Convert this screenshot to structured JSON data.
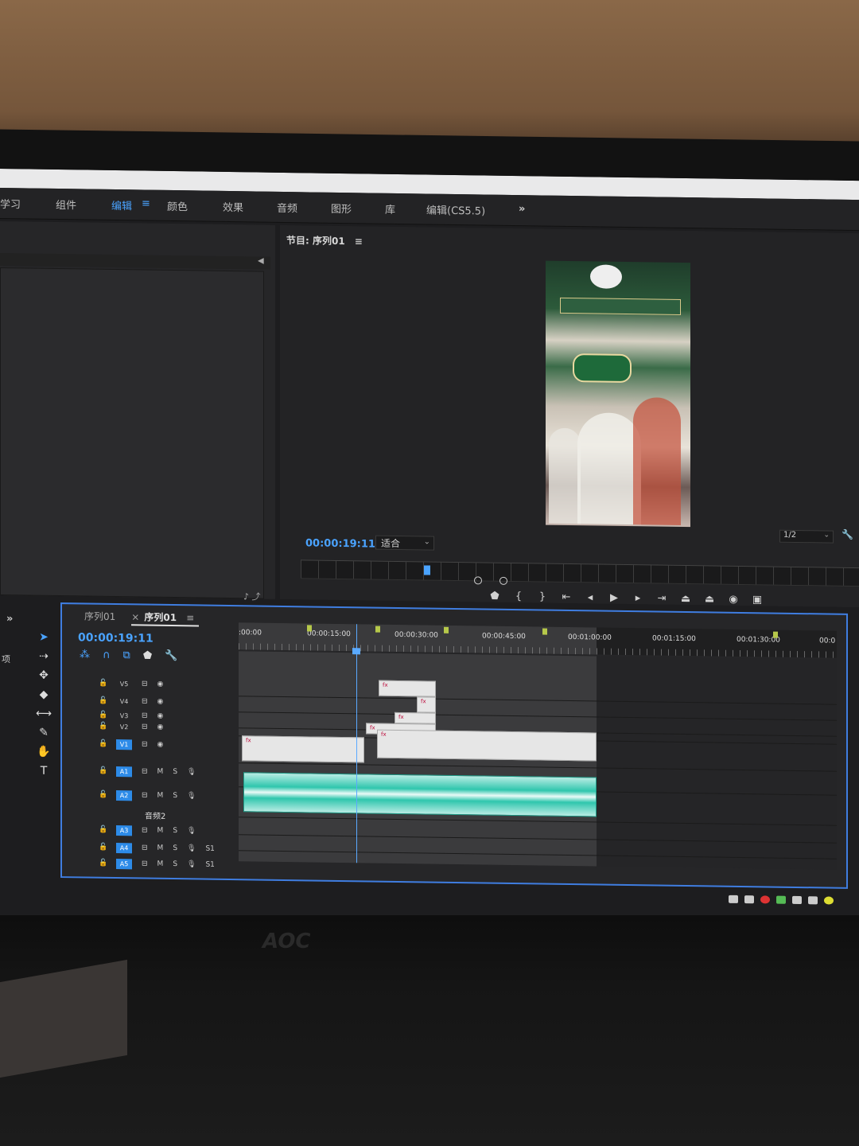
{
  "workspaces": [
    "学习",
    "组件",
    "编辑",
    "颜色",
    "效果",
    "音频",
    "图形",
    "库",
    "编辑(CS5.5)"
  ],
  "active_workspace_menu": "≡",
  "workspace_more": "»",
  "program_monitor": {
    "title": "节目: 序列01",
    "menu": "≡",
    "timecode": "00:00:19:11",
    "fit": "适合",
    "resolution": "1/2"
  },
  "timeline": {
    "tab_inactive": "序列01",
    "tab_close": "×",
    "tab_active": "序列01",
    "tab_menu": "≡",
    "timecode": "00:00:19:11",
    "ruler_labels": [
      ":00:00",
      "00:00:15:00",
      "00:00:30:00",
      "00:00:45:00",
      "00:01:00:00",
      "00:01:15:00",
      "00:01:30:00",
      "00:0"
    ],
    "video_tracks": [
      "V5",
      "V4",
      "V3",
      "V2",
      "V1"
    ],
    "audio_tracks": [
      "A1",
      "A2",
      "A3",
      "A4",
      "A5"
    ],
    "audio_track_label": "音频2",
    "audio_buttons": [
      "M",
      "S"
    ],
    "panel_level_labels": [
      "S1",
      "S1"
    ]
  },
  "left_panel": {
    "sidebar_text": "项",
    "more": "»"
  },
  "monitor_brand": "AOC"
}
